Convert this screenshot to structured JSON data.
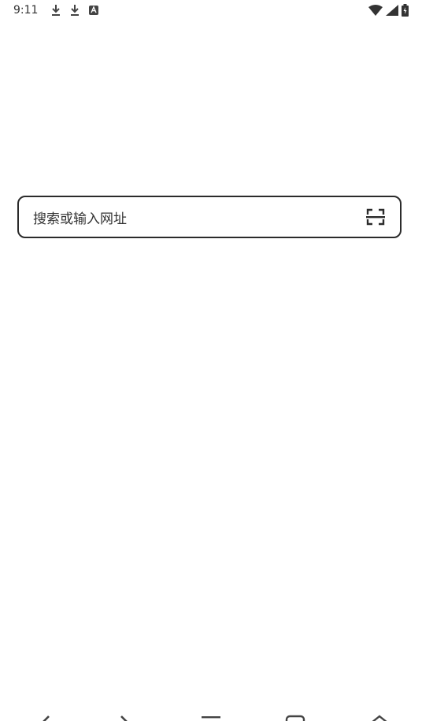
{
  "status_bar": {
    "time": "9:11",
    "left_icons": [
      "download-icon",
      "download-icon",
      "app-notification-icon"
    ],
    "right_icons": [
      "wifi-icon",
      "cellular-signal-icon",
      "battery-charging-icon"
    ]
  },
  "search": {
    "placeholder": "搜索或输入网址",
    "scan_icon": "scan-icon"
  },
  "bottom_nav": {
    "items": [
      "back-icon",
      "forward-icon",
      "menu-icon",
      "tabs-icon",
      "home-icon"
    ]
  }
}
